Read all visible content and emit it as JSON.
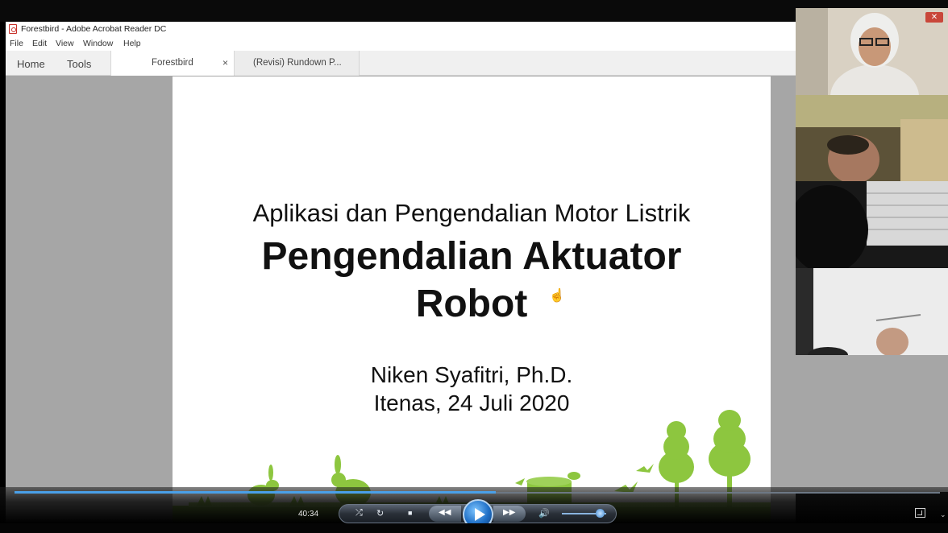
{
  "window": {
    "title": "Forestbird - Adobe Acrobat Reader DC"
  },
  "menu": [
    "File",
    "Edit",
    "View",
    "Window",
    "Help"
  ],
  "nav_tabs": {
    "home": "Home",
    "tools": "Tools"
  },
  "doc_tabs": [
    {
      "label": "Forestbird",
      "close": "×"
    },
    {
      "label": "(Revisi) Rundown P..."
    }
  ],
  "slide": {
    "subtitle": "Aplikasi dan Pengendalian Motor Listrik",
    "title_line1": "Pengendalian Aktuator",
    "title_line2": "Robot",
    "author": "Niken Syafitri, Ph.D.",
    "affiliation": "Itenas, 24 Juli 2020"
  },
  "player": {
    "timestamp": "40:34",
    "progress": 0.52,
    "volume": 0.85
  },
  "colors": {
    "accent": "#8dc63f",
    "player_blue": "#1f6fc6"
  }
}
